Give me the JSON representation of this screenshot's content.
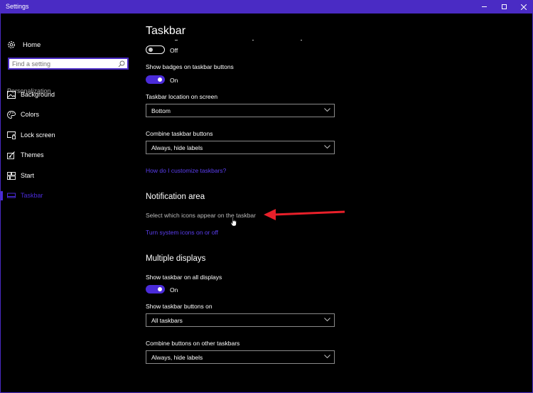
{
  "window": {
    "title": "Settings",
    "controls": {
      "minimize": "minimize",
      "maximize": "maximize",
      "close": "close"
    },
    "accent_color": "#4a2bc4"
  },
  "sidebar": {
    "home_label": "Home",
    "search_placeholder": "Find a setting",
    "section_label": "Personalization",
    "items": [
      {
        "label": "Background",
        "icon": "picture-icon",
        "active": false
      },
      {
        "label": "Colors",
        "icon": "palette-icon",
        "active": false
      },
      {
        "label": "Lock screen",
        "icon": "lock-screen-icon",
        "active": false
      },
      {
        "label": "Themes",
        "icon": "themes-icon",
        "active": false
      },
      {
        "label": "Start",
        "icon": "start-icon",
        "active": false
      },
      {
        "label": "Taskbar",
        "icon": "taskbar-icon",
        "active": true
      }
    ]
  },
  "main": {
    "title": "Taskbar",
    "first_toggle": {
      "state": "Off",
      "on": false
    },
    "badges": {
      "label": "Show badges on taskbar buttons",
      "state": "On",
      "on": true
    },
    "location": {
      "label": "Taskbar location on screen",
      "value": "Bottom"
    },
    "combine": {
      "label": "Combine taskbar buttons",
      "value": "Always, hide labels"
    },
    "customize_link": "How do I customize taskbars?",
    "notification": {
      "heading": "Notification area",
      "select_icons": "Select which icons appear on the taskbar",
      "system_icons_link": "Turn system icons on or off"
    },
    "multiple": {
      "heading": "Multiple displays",
      "show_all": {
        "label": "Show taskbar on all displays",
        "state": "On",
        "on": true
      },
      "buttons_on": {
        "label": "Show taskbar buttons on",
        "value": "All taskbars"
      },
      "combine_other": {
        "label": "Combine buttons on other taskbars",
        "value": "Always, hide labels"
      }
    }
  },
  "annotation": {
    "arrow_color": "#e8202a"
  }
}
